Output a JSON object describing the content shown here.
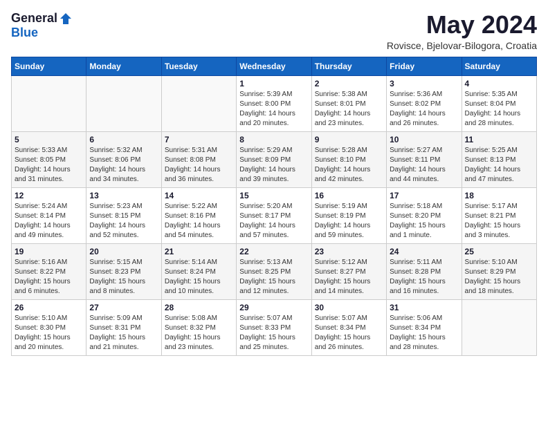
{
  "header": {
    "logo": {
      "general": "General",
      "blue": "Blue"
    },
    "title": "May 2024",
    "location": "Rovisce, Bjelovar-Bilogora, Croatia"
  },
  "calendar": {
    "days_of_week": [
      "Sunday",
      "Monday",
      "Tuesday",
      "Wednesday",
      "Thursday",
      "Friday",
      "Saturday"
    ],
    "weeks": [
      [
        {
          "day": "",
          "info": ""
        },
        {
          "day": "",
          "info": ""
        },
        {
          "day": "",
          "info": ""
        },
        {
          "day": "1",
          "info": "Sunrise: 5:39 AM\nSunset: 8:00 PM\nDaylight: 14 hours\nand 20 minutes."
        },
        {
          "day": "2",
          "info": "Sunrise: 5:38 AM\nSunset: 8:01 PM\nDaylight: 14 hours\nand 23 minutes."
        },
        {
          "day": "3",
          "info": "Sunrise: 5:36 AM\nSunset: 8:02 PM\nDaylight: 14 hours\nand 26 minutes."
        },
        {
          "day": "4",
          "info": "Sunrise: 5:35 AM\nSunset: 8:04 PM\nDaylight: 14 hours\nand 28 minutes."
        }
      ],
      [
        {
          "day": "5",
          "info": "Sunrise: 5:33 AM\nSunset: 8:05 PM\nDaylight: 14 hours\nand 31 minutes."
        },
        {
          "day": "6",
          "info": "Sunrise: 5:32 AM\nSunset: 8:06 PM\nDaylight: 14 hours\nand 34 minutes."
        },
        {
          "day": "7",
          "info": "Sunrise: 5:31 AM\nSunset: 8:08 PM\nDaylight: 14 hours\nand 36 minutes."
        },
        {
          "day": "8",
          "info": "Sunrise: 5:29 AM\nSunset: 8:09 PM\nDaylight: 14 hours\nand 39 minutes."
        },
        {
          "day": "9",
          "info": "Sunrise: 5:28 AM\nSunset: 8:10 PM\nDaylight: 14 hours\nand 42 minutes."
        },
        {
          "day": "10",
          "info": "Sunrise: 5:27 AM\nSunset: 8:11 PM\nDaylight: 14 hours\nand 44 minutes."
        },
        {
          "day": "11",
          "info": "Sunrise: 5:25 AM\nSunset: 8:13 PM\nDaylight: 14 hours\nand 47 minutes."
        }
      ],
      [
        {
          "day": "12",
          "info": "Sunrise: 5:24 AM\nSunset: 8:14 PM\nDaylight: 14 hours\nand 49 minutes."
        },
        {
          "day": "13",
          "info": "Sunrise: 5:23 AM\nSunset: 8:15 PM\nDaylight: 14 hours\nand 52 minutes."
        },
        {
          "day": "14",
          "info": "Sunrise: 5:22 AM\nSunset: 8:16 PM\nDaylight: 14 hours\nand 54 minutes."
        },
        {
          "day": "15",
          "info": "Sunrise: 5:20 AM\nSunset: 8:17 PM\nDaylight: 14 hours\nand 57 minutes."
        },
        {
          "day": "16",
          "info": "Sunrise: 5:19 AM\nSunset: 8:19 PM\nDaylight: 14 hours\nand 59 minutes."
        },
        {
          "day": "17",
          "info": "Sunrise: 5:18 AM\nSunset: 8:20 PM\nDaylight: 15 hours\nand 1 minute."
        },
        {
          "day": "18",
          "info": "Sunrise: 5:17 AM\nSunset: 8:21 PM\nDaylight: 15 hours\nand 3 minutes."
        }
      ],
      [
        {
          "day": "19",
          "info": "Sunrise: 5:16 AM\nSunset: 8:22 PM\nDaylight: 15 hours\nand 6 minutes."
        },
        {
          "day": "20",
          "info": "Sunrise: 5:15 AM\nSunset: 8:23 PM\nDaylight: 15 hours\nand 8 minutes."
        },
        {
          "day": "21",
          "info": "Sunrise: 5:14 AM\nSunset: 8:24 PM\nDaylight: 15 hours\nand 10 minutes."
        },
        {
          "day": "22",
          "info": "Sunrise: 5:13 AM\nSunset: 8:25 PM\nDaylight: 15 hours\nand 12 minutes."
        },
        {
          "day": "23",
          "info": "Sunrise: 5:12 AM\nSunset: 8:27 PM\nDaylight: 15 hours\nand 14 minutes."
        },
        {
          "day": "24",
          "info": "Sunrise: 5:11 AM\nSunset: 8:28 PM\nDaylight: 15 hours\nand 16 minutes."
        },
        {
          "day": "25",
          "info": "Sunrise: 5:10 AM\nSunset: 8:29 PM\nDaylight: 15 hours\nand 18 minutes."
        }
      ],
      [
        {
          "day": "26",
          "info": "Sunrise: 5:10 AM\nSunset: 8:30 PM\nDaylight: 15 hours\nand 20 minutes."
        },
        {
          "day": "27",
          "info": "Sunrise: 5:09 AM\nSunset: 8:31 PM\nDaylight: 15 hours\nand 21 minutes."
        },
        {
          "day": "28",
          "info": "Sunrise: 5:08 AM\nSunset: 8:32 PM\nDaylight: 15 hours\nand 23 minutes."
        },
        {
          "day": "29",
          "info": "Sunrise: 5:07 AM\nSunset: 8:33 PM\nDaylight: 15 hours\nand 25 minutes."
        },
        {
          "day": "30",
          "info": "Sunrise: 5:07 AM\nSunset: 8:34 PM\nDaylight: 15 hours\nand 26 minutes."
        },
        {
          "day": "31",
          "info": "Sunrise: 5:06 AM\nSunset: 8:34 PM\nDaylight: 15 hours\nand 28 minutes."
        },
        {
          "day": "",
          "info": ""
        }
      ]
    ]
  }
}
